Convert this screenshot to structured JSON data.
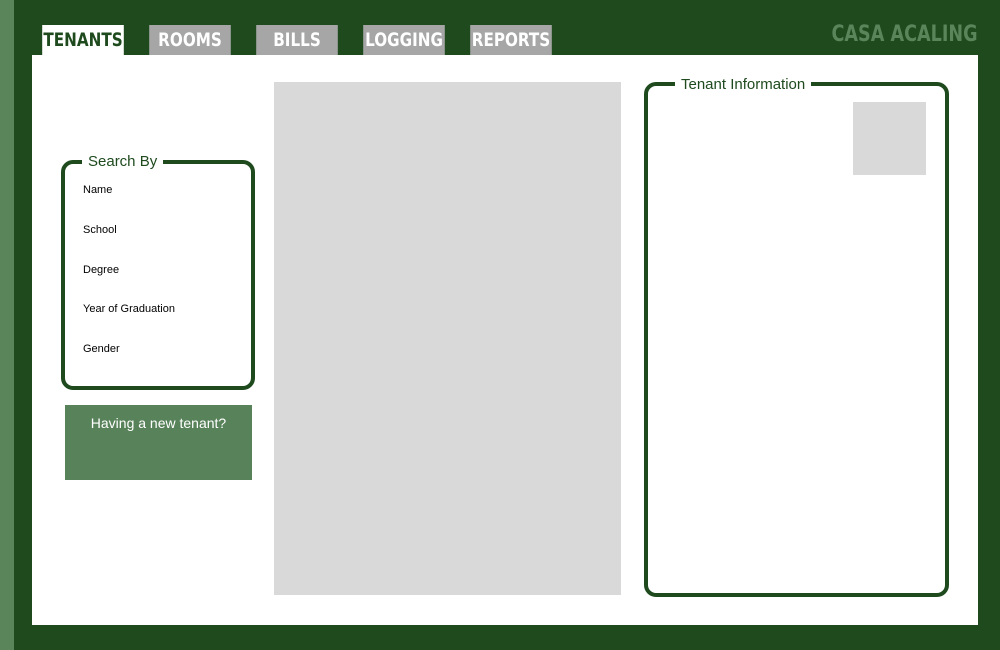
{
  "app": {
    "brand": "CASA ACALING"
  },
  "tabs": [
    {
      "label": "TENANTS"
    },
    {
      "label": "ROOMS"
    },
    {
      "label": "BILLS"
    },
    {
      "label": "LOGGING"
    },
    {
      "label": "REPORTS"
    }
  ],
  "search": {
    "legend": "Search By",
    "options": [
      "Name",
      "School",
      "Degree",
      "Year of Graduation",
      "Gender"
    ]
  },
  "new_tenant": {
    "label": "Having a new tenant?"
  },
  "tenant_info": {
    "legend": "Tenant Information"
  },
  "colors": {
    "frame": "#1e4a1e",
    "accent": "#5a845a",
    "tab_inactive": "#a6a6a6",
    "placeholder": "#d9d9d9"
  }
}
